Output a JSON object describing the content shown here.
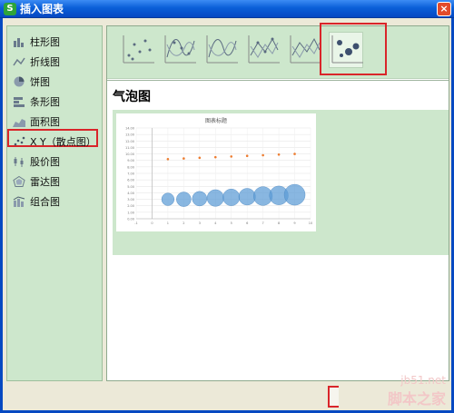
{
  "window": {
    "title": "插入图表",
    "close": "×",
    "app_icon": "S"
  },
  "sidebar": {
    "items": [
      {
        "label": "柱形图",
        "icon": "bar-chart-icon"
      },
      {
        "label": "折线图",
        "icon": "line-chart-icon"
      },
      {
        "label": "饼图",
        "icon": "pie-chart-icon"
      },
      {
        "label": "条形图",
        "icon": "horizontal-bar-chart-icon"
      },
      {
        "label": "面积图",
        "icon": "area-chart-icon"
      },
      {
        "label": "X Y（散点图）",
        "icon": "scatter-chart-icon"
      },
      {
        "label": "股价图",
        "icon": "stock-chart-icon"
      },
      {
        "label": "雷达图",
        "icon": "radar-chart-icon"
      },
      {
        "label": "组合图",
        "icon": "combo-chart-icon"
      }
    ],
    "selected_index": 5
  },
  "subtypes": {
    "items": [
      "scatter-markers-only",
      "scatter-smooth-lines-markers",
      "scatter-smooth-lines",
      "scatter-straight-lines-markers",
      "scatter-straight-lines",
      "bubble"
    ],
    "selected_index": 5
  },
  "heading": "气泡图",
  "preview": {
    "chart_title": "图表标题",
    "accent": "#5b9bd5",
    "marker_color": "#ed7d31"
  },
  "chart_data": {
    "type": "scatter",
    "title": "图表标题",
    "xlabel": "",
    "ylabel": "",
    "xlim": [
      -1,
      10
    ],
    "ylim": [
      0,
      14
    ],
    "x_ticks": [
      -1,
      0,
      1,
      2,
      3,
      4,
      5,
      6,
      7,
      8,
      9,
      10
    ],
    "y_ticks": [
      0,
      1,
      2,
      3,
      4,
      5,
      6,
      7,
      8,
      9,
      10,
      11,
      12,
      13,
      14
    ],
    "series": [
      {
        "x": [
          1,
          2,
          3,
          4,
          5,
          6,
          7,
          8,
          9
        ],
        "y": [
          3.0,
          3.0,
          3.1,
          3.2,
          3.3,
          3.4,
          3.5,
          3.6,
          3.7
        ],
        "size": [
          6,
          7,
          7,
          8,
          8,
          8,
          9,
          9,
          10
        ],
        "color": "#5b9bd5"
      },
      {
        "x": [
          1,
          2,
          3,
          4,
          5,
          6,
          7,
          8,
          9
        ],
        "y": [
          9.2,
          9.3,
          9.4,
          9.5,
          9.6,
          9.7,
          9.8,
          9.9,
          10.0
        ],
        "color": "#ed7d31"
      }
    ],
    "grid": true
  },
  "watermark": {
    "url": "jb51.net",
    "text": "脚本之家"
  }
}
